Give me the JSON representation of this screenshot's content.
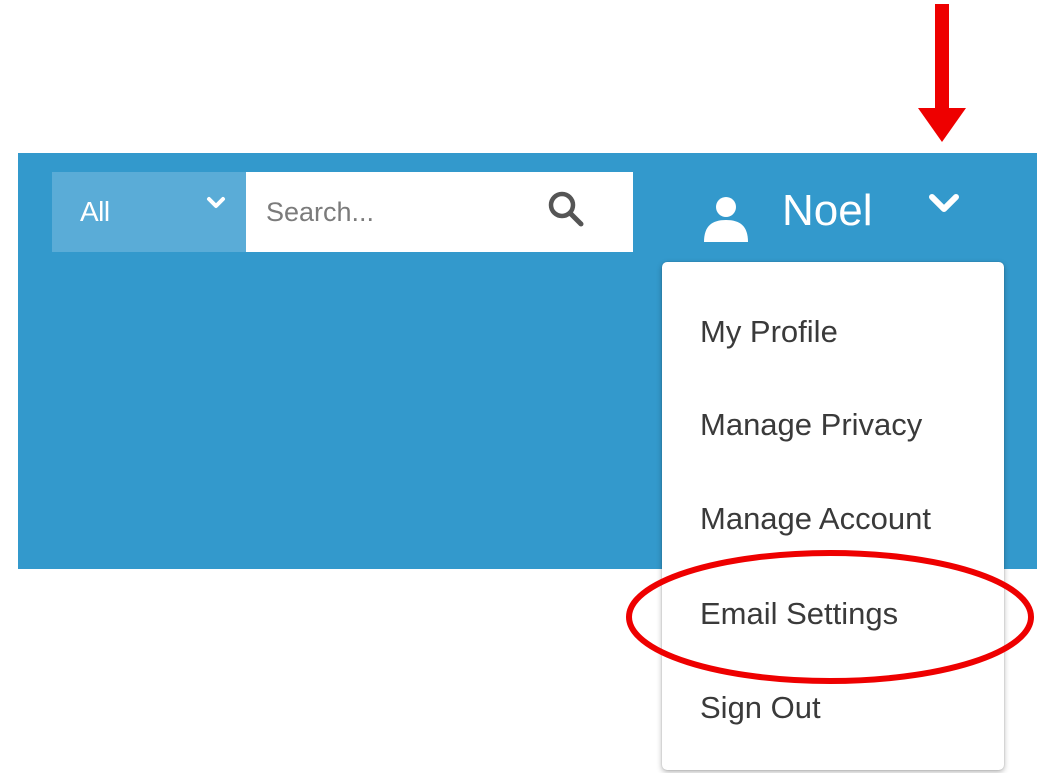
{
  "colors": {
    "header_bg": "#3399cc",
    "scope_bg": "#5aacd7",
    "annotation": "#ee0000",
    "menu_text": "#3a3a3a"
  },
  "search": {
    "scope_label": "All",
    "placeholder": "Search...",
    "value": ""
  },
  "user": {
    "name": "Noel"
  },
  "menu": {
    "items": [
      {
        "label": "My Profile"
      },
      {
        "label": "Manage Privacy"
      },
      {
        "label": "Manage Account"
      },
      {
        "label": "Email Settings"
      },
      {
        "label": "Sign Out"
      }
    ]
  },
  "icons": {
    "scope_dropdown": "chevron-down-icon",
    "search": "search-icon",
    "user": "user-icon",
    "user_menu": "chevron-down-icon"
  }
}
